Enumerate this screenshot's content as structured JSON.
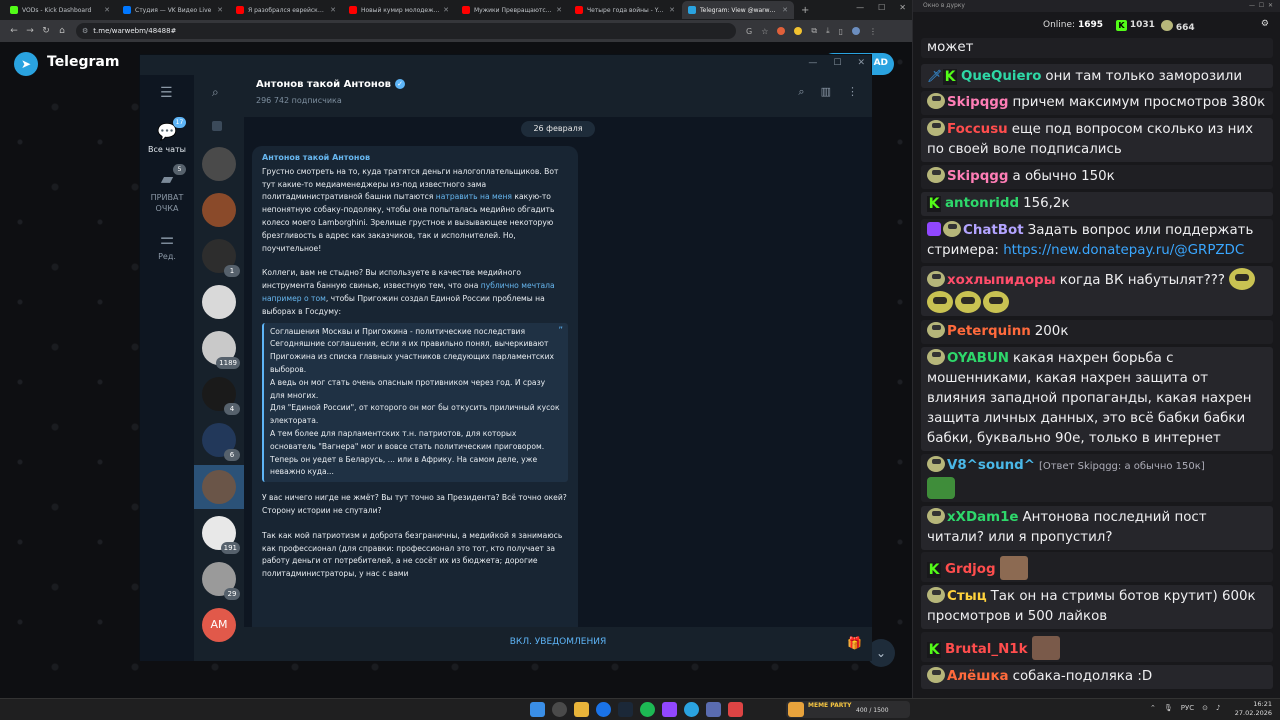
{
  "browser": {
    "tabs": [
      {
        "label": "VODs - Kick Dashboard",
        "color": "#53fc18"
      },
      {
        "label": "Студия — VK Видео Live",
        "color": "#0077ff"
      },
      {
        "label": "Я разобрался еврейское п",
        "color": "#ff0000"
      },
      {
        "label": "Новый кумир молодежи, п",
        "color": "#ff0000"
      },
      {
        "label": "Мужики Превращаются в Ж",
        "color": "#ff0000"
      },
      {
        "label": "Четыре года войны - YouTu",
        "color": "#ff0000"
      },
      {
        "label": "Telegram: View @warwebm",
        "color": "#2aa3e0"
      }
    ],
    "url": "t.me/warwebm/48488#"
  },
  "telegram_page": {
    "logo_text": "Telegram",
    "right_button": "AD"
  },
  "tgwin": {
    "folders": [
      {
        "label": "Все чаты",
        "badge": "17"
      },
      {
        "label": "ПРИВАТ ОЧКА",
        "badge": "5"
      },
      {
        "label": "Ред.",
        "badge": ""
      }
    ],
    "chat_badges": [
      "1",
      "1189",
      "4",
      "6",
      "191",
      "29"
    ],
    "avatar_initials": "AM",
    "channel_name": "Антонов такой Антонов",
    "subscribers": "296 742 подписчика",
    "date_label": "26 февраля",
    "message": {
      "author": "Антонов такой Антонов",
      "p1": "Грустно смотреть на то, куда тратятся деньги налогоплательщиков. Вот тут какие-то медиаменеджеры из-под известного зама политадминистративной башни пытаются",
      "p1_link": "натравить на меня",
      "p1_rest": "какую-то непонятную собаку-подоляку, чтобы она попыталась медийно обгадить колесо моего Lamborghini. Зрелище грустное и вызывающее некоторую брезгливость в адрес как заказчиков, так и исполнителей. Но, поучительное!",
      "p2": "Коллеги, вам не стыдно? Вы используете в качестве медийного инструмента банную свинью, известную тем, что она",
      "p2_link": "публично мечтала например о том",
      "p2_rest": ", чтобы Пригожин создал Единой России проблемы на выборах в Госдуму:",
      "quote": "Соглашения Москвы и Пригожина - политические последствия\nСегодняшние соглашения, если я их правильно понял, вычеркивают Пригожина из списка главных участников следующих парламентских выборов.\nА ведь он мог стать очень опасным противником через год. И сразу для многих.\nДля \"Единой России\", от которого он мог бы откусить приличный кусок электората.\nА тем более для парламентских т.н. патриотов, для которых основатель \"Вагнера\" мог и вовсе стать политическим приговором.\nТеперь он уедет в Беларусь, ... или в Африку. На самом деле, уже неважно куда...",
      "p3": "У вас ничего нигде не жмёт? Вы тут точно за Президента? Всё точно окей? Сторону истории не спутали?",
      "p4": "Так как мой патриотизм и доброта безграничны, а медийкой я занимаюсь как профессионал (для справки: профессионал это тот, кто получает за работу деньги от потребителей, а не сосёт их из бюджета; дорогие политадминистраторы, у нас с вами"
    },
    "notify_button": "ВКЛ. УВЕДОМЛЕНИЯ"
  },
  "chat_panel": {
    "window_title": "Окно в дурку",
    "online_label": "Online:",
    "online_count": "1695",
    "count_k": "1031",
    "count_other": "664",
    "messages": [
      {
        "user": "",
        "color": "#efeff1",
        "text": "может"
      },
      {
        "user": "QueQuiero",
        "color": "#2ed8a6",
        "text": "они там только заморозили"
      },
      {
        "user": "Skipqgg",
        "color": "#ff7eb6",
        "text": "причем максимум просмотров 380к"
      },
      {
        "user": "Foccusu",
        "color": "#ff4d4d",
        "text": "еще под вопросом сколько из них по своей воле подписались"
      },
      {
        "user": "Skipqgg",
        "color": "#ff7eb6",
        "text": "а обычно 150к"
      },
      {
        "user": "antonridd",
        "color": "#2ed86b",
        "text": "156,2к"
      },
      {
        "user": "ChatBot",
        "color": "#b3a4ff",
        "text": "Задать вопрос или поддержать стримера: ",
        "link": "https://new.donatepay.ru/@GRPZDC"
      },
      {
        "user": "хохлыпидоры",
        "color": "#ff4d6a",
        "text": "когда ВК набутылят???"
      },
      {
        "user": "Peterquinn",
        "color": "#ff6a3c",
        "text": "200к"
      },
      {
        "user": "OYABUN",
        "color": "#2ed86b",
        "text": "какая нахрен борьба с мошенниками, какая нахрен защита от влияния западной пропаганды, какая нахрен защита личных данных, это всё бабки бабки бабки, буквально 90е, только в интернет пространстве"
      },
      {
        "user": "V8^sound^",
        "color": "#4ab8e8",
        "text": "",
        "reply": "[Ответ Skipqgg: а обычно 150к]"
      },
      {
        "user": "xXDam1e",
        "color": "#2ed86b",
        "text": "Антонова последний пост читали? или я пропустил?"
      },
      {
        "user": "Grdjog",
        "color": "#ff4d4d",
        "text": ""
      },
      {
        "user": "Стыц",
        "color": "#ffd23c",
        "text": "Так он на стримы ботов крутит) 600к просмотров и 500 лайков"
      },
      {
        "user": "Brutal_N1k",
        "color": "#ff4d4d",
        "text": ""
      },
      {
        "user": "Алёшка",
        "color": "#ff6a3c",
        "text": "собака-подоляка :D"
      }
    ]
  },
  "taskbar": {
    "widget_name": "MEME PARTY",
    "widget_count": "400 / 1500",
    "lang": "РУС",
    "time": "16:21",
    "date": "27.02.2026"
  }
}
